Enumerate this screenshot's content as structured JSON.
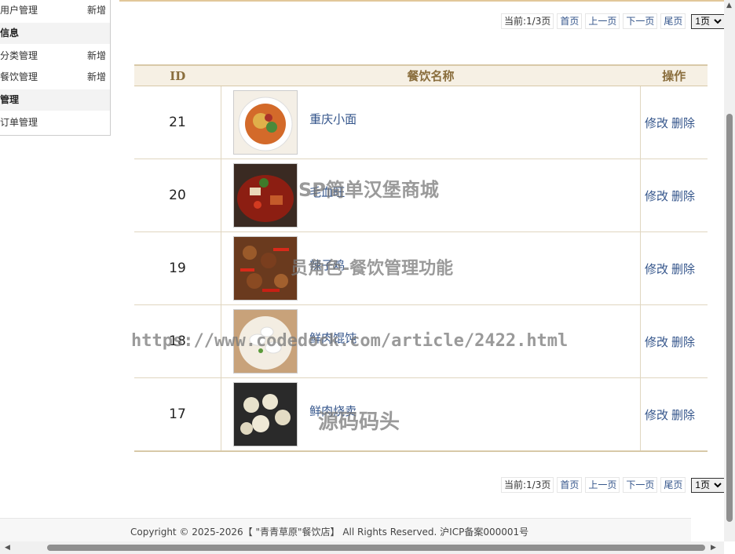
{
  "sidebar": {
    "rows": [
      {
        "label": "用户管理",
        "add": "新增"
      },
      {
        "label": "信息"
      },
      {
        "label": "分类管理",
        "add": "新增"
      },
      {
        "label": "餐饮管理",
        "add": "新增"
      },
      {
        "label": "管理"
      },
      {
        "label": "订单管理"
      }
    ]
  },
  "pager": {
    "current": "当前:1/3页",
    "first": "首页",
    "prev": "上一页",
    "next": "下一页",
    "last": "尾页",
    "select": "1页"
  },
  "table": {
    "headers": {
      "id": "ID",
      "name": "餐饮名称",
      "op": "操作"
    },
    "rows": [
      {
        "id": "21",
        "name": "重庆小面",
        "image": "noodle-dish-image"
      },
      {
        "id": "20",
        "name": "毛血旺",
        "image": "spicy-stew-image"
      },
      {
        "id": "19",
        "name": "辣子鸡",
        "image": "spicy-chicken-image"
      },
      {
        "id": "18",
        "name": "鲜肉馄饨",
        "image": "wonton-soup-image"
      },
      {
        "id": "17",
        "name": "鲜肉烧卖",
        "image": "shaomai-image"
      }
    ],
    "edit_label": "修改",
    "delete_label": "删除"
  },
  "watermarks": {
    "line1": "SP简单汉堡商城",
    "line2": "员角色-餐饮管理功能",
    "line3": "https://www.codedock.com/article/2422.html",
    "line4": "源码码头"
  },
  "footer": {
    "text": "Copyright © 2025-2026【 \"青青草原\"餐饮店】 All Rights Reserved. 沪ICP备案000001号"
  }
}
